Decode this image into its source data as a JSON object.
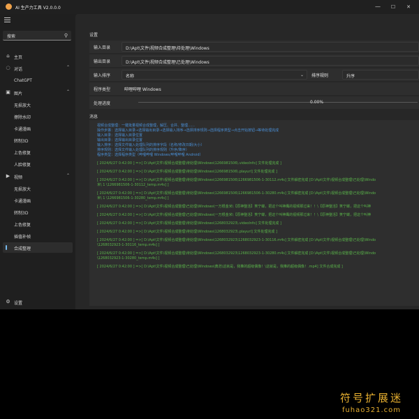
{
  "app": {
    "title": "AI 生产力工具 V2.0.0.0"
  },
  "window_controls": {
    "minimize": "—",
    "maximize": "☐",
    "close": "✕"
  },
  "sidebar": {
    "search_placeholder": "搜索",
    "items": [
      {
        "label": "主页",
        "icon": "home-icon"
      },
      {
        "label": "对话",
        "icon": "chat-icon",
        "expandable": true
      },
      {
        "label": "ChatGPT"
      },
      {
        "label": "图片",
        "icon": "image-icon",
        "expandable": true
      },
      {
        "label": "无损放大"
      },
      {
        "label": "擦除水印"
      },
      {
        "label": "卡通漫画"
      },
      {
        "label": "转制3D"
      },
      {
        "label": "上色修复"
      },
      {
        "label": "人脸修复"
      },
      {
        "label": "视频",
        "icon": "video-icon",
        "expandable": true
      },
      {
        "label": "无损放大"
      },
      {
        "label": "卡通漫画"
      },
      {
        "label": "转制3D"
      },
      {
        "label": "上色修复"
      },
      {
        "label": "插值补帧"
      },
      {
        "label": "合成整理",
        "active": true
      }
    ],
    "settings_label": "设置"
  },
  "settings": {
    "section_title": "设置",
    "input_dir_label": "输入目录",
    "input_dir_value": "D:\\Apt\\文件\\视频合成整理\\待处理\\Windows",
    "output_dir_label": "输出目录",
    "output_dir_value": "D:\\Apt\\文件\\视频合成整理\\已处理\\Windows",
    "sort_label": "输入排序",
    "sort_value": "名称",
    "sort_rule_label": "排序规则",
    "sort_rule_value": "升序",
    "program_type_label": "程序类型",
    "program_type_value": "哔哩哔哩 Windows",
    "progress_label": "处理进度",
    "progress_text": "0.00%",
    "progress_fraction": 0.0
  },
  "messages": {
    "section_title": "消息",
    "lines": [
      {
        "text": "视频合成整理：一键批量视频合成整理，解压、合并、整理……",
        "color": "blue"
      },
      {
        "text": "操作步骤：选择输入目录→选择输出目录→选择输入排序→选择排序规则→选择程序类型→点击开始按钮→等待处理完成",
        "color": "blue"
      },
      {
        "text": "输入目录：选择输入目录位置",
        "color": "blue"
      },
      {
        "text": "输出目录：选择输出目录位置",
        "color": "blue"
      },
      {
        "text": "输入排序：选择文件输入处理队列的排序字段（名称/修改日期/大小）",
        "color": "blue"
      },
      {
        "text": "排序规则：选择文件输入处理队列的排序规则（升序/降序）",
        "color": "blue"
      },
      {
        "text": "程序类型：选择程序类型（哔哩哔哩 Windows/哔哩哔哩 Android）",
        "color": "blue"
      },
      {
        "text": "",
        "color": "green"
      },
      {
        "text": "[ 2024/6/27 0:42:00 ] =>[ D:\\Apt\\文件\\视频合成整理\\待处理\\Windows\\1266981506\\.videoInfo] 文件处理完成 ]",
        "color": "green"
      },
      {
        "text": "",
        "color": "green"
      },
      {
        "text": "[ 2024/6/27 0:42:00 ] =>[ D:\\Apt\\文件\\视频合成整理\\待处理\\Windows\\1266981506\\.playurl] 文件处理完成 ]",
        "color": "green"
      },
      {
        "text": "",
        "color": "green"
      },
      {
        "text": "[ 2024/6/27 0:42:00 ] =>[ D:\\Apt\\文件\\视频合成整理\\待处理\\Windows\\1266981506\\1266981506-1-30112.m4s] 文件解密完成 [D:\\Apt\\文件\\视频合成整理\\已处理\\Windo",
        "color": "green"
      },
      {
        "text": "米\\ 1 \\1266981506-1-30112_temp.m4s] ]",
        "color": "green"
      },
      {
        "text": "",
        "color": "green"
      },
      {
        "text": "[ 2024/6/27 0:42:00 ] =>[ D:\\Apt\\文件\\视频合成整理\\待处理\\Windows\\1266981506\\1266981506-1-30280.m4s] 文件解密完成 [D:\\Apt\\文件\\视频合成整理\\已处理\\Windo",
        "color": "green"
      },
      {
        "text": "米\\ 1 \\1266981506-1-30280_temp.m4s] ]",
        "color": "green"
      },
      {
        "text": "",
        "color": "green"
      },
      {
        "text": "[ 2024/6/27 0:42:00 ] =>[ D:\\Apt\\文件\\视频合成整理\\已处理\\Windows\\一万根金米\\【原神整活】笑宁蝶，把这个叫神鹰的视频那过来！！\\【原神整活】笑宁蝶，把这个叫神",
        "color": "green"
      },
      {
        "text": "",
        "color": "green"
      },
      {
        "text": "[ 2024/6/27 0:42:00 ] =>[ D:\\Apt\\文件\\视频合成整理\\已处理\\Windows\\一万根金米\\【原神整活】笑宁蝶，把这个叫神鹰的视频那过来！！\\【原神整活】笑宁蝶，把这个叫神",
        "color": "green"
      },
      {
        "text": "",
        "color": "green"
      },
      {
        "text": "[ 2024/6/27 0:42:00 ] =>[ D:\\Apt\\文件\\视频合成整理\\待处理\\Windows\\1268032923\\.videoInfo] 文件处理完成 ]",
        "color": "green"
      },
      {
        "text": "",
        "color": "green"
      },
      {
        "text": "[ 2024/6/27 0:42:00 ] =>[ D:\\Apt\\文件\\视频合成整理\\待处理\\Windows\\1268032923\\.playurl] 文件处理完成 ]",
        "color": "green"
      },
      {
        "text": "",
        "color": "green"
      },
      {
        "text": "[ 2024/6/27 0:42:00 ] =>[ D:\\Apt\\文件\\视频合成整理\\待处理\\Windows\\1268032923\\1268032923-1-30116.m4s] 文件解密完成 [D:\\Apt\\文件\\视频合成整理\\已处理\\Windo",
        "color": "green"
      },
      {
        "text": "\\1268032923-1-30116_temp.m4s] ]",
        "color": "green"
      },
      {
        "text": "",
        "color": "green"
      },
      {
        "text": "[ 2024/6/27 0:42:00 ] =>[ D:\\Apt\\文件\\视频合成整理\\待处理\\Windows\\1268032923\\1268032923-1-30280.m4s] 文件解密完成 [D:\\Apt\\文件\\视频合成整理\\已处理\\Windo",
        "color": "green"
      },
      {
        "text": "\\1268032923-1-30280_temp.m4s] ]",
        "color": "green"
      },
      {
        "text": "",
        "color": "green"
      },
      {
        "text": "[ 2024/6/27 0:42:00 ] =>[ D:\\Apt\\文件\\视频合成整理\\已处理\\Windows\\典范\\这就是，我推的超级偶像！\\这就是，我推的超级偶像！.mp4] 文件合成完成 ]",
        "color": "green"
      }
    ]
  },
  "watermark": {
    "cn": "符号扩展迷",
    "en": "fuhao321.com"
  }
}
